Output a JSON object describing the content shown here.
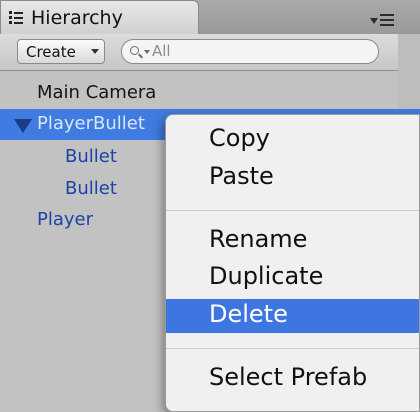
{
  "tab": {
    "title": "Hierarchy",
    "icon": "list-icon",
    "menu_icon": "panel-menu-icon"
  },
  "toolbar": {
    "create_label": "Create",
    "create_dropdown_icon": "caret-down-icon",
    "search": {
      "placeholder": "All",
      "value": "",
      "icon": "search-icon"
    }
  },
  "hierarchy": {
    "items": [
      {
        "label": "Main Camera",
        "selected": false,
        "expanded": null,
        "depth": 0,
        "color": "#141414"
      },
      {
        "label": "PlayerBullet",
        "selected": true,
        "expanded": true,
        "depth": 0,
        "color": "#d9e6fb"
      },
      {
        "label": "Bullet",
        "selected": false,
        "expanded": null,
        "depth": 1,
        "color": "#1e43a8"
      },
      {
        "label": "Bullet",
        "selected": false,
        "expanded": null,
        "depth": 1,
        "color": "#1e43a8"
      },
      {
        "label": "Player",
        "selected": false,
        "expanded": null,
        "depth": 0,
        "color": "#1e43a8"
      }
    ]
  },
  "context_menu": {
    "items": [
      {
        "label": "Copy",
        "highlighted": false
      },
      {
        "label": "Paste",
        "highlighted": false
      },
      {
        "label": "Rename",
        "highlighted": false
      },
      {
        "label": "Duplicate",
        "highlighted": false
      },
      {
        "label": "Delete",
        "highlighted": true
      },
      {
        "label": "Select Prefab",
        "highlighted": false
      }
    ]
  },
  "colors": {
    "selection": "#3f7be0",
    "menu_highlight": "#3d76e1",
    "panel_background": "#c2c2c2",
    "menu_background": "#f0f0f0"
  }
}
